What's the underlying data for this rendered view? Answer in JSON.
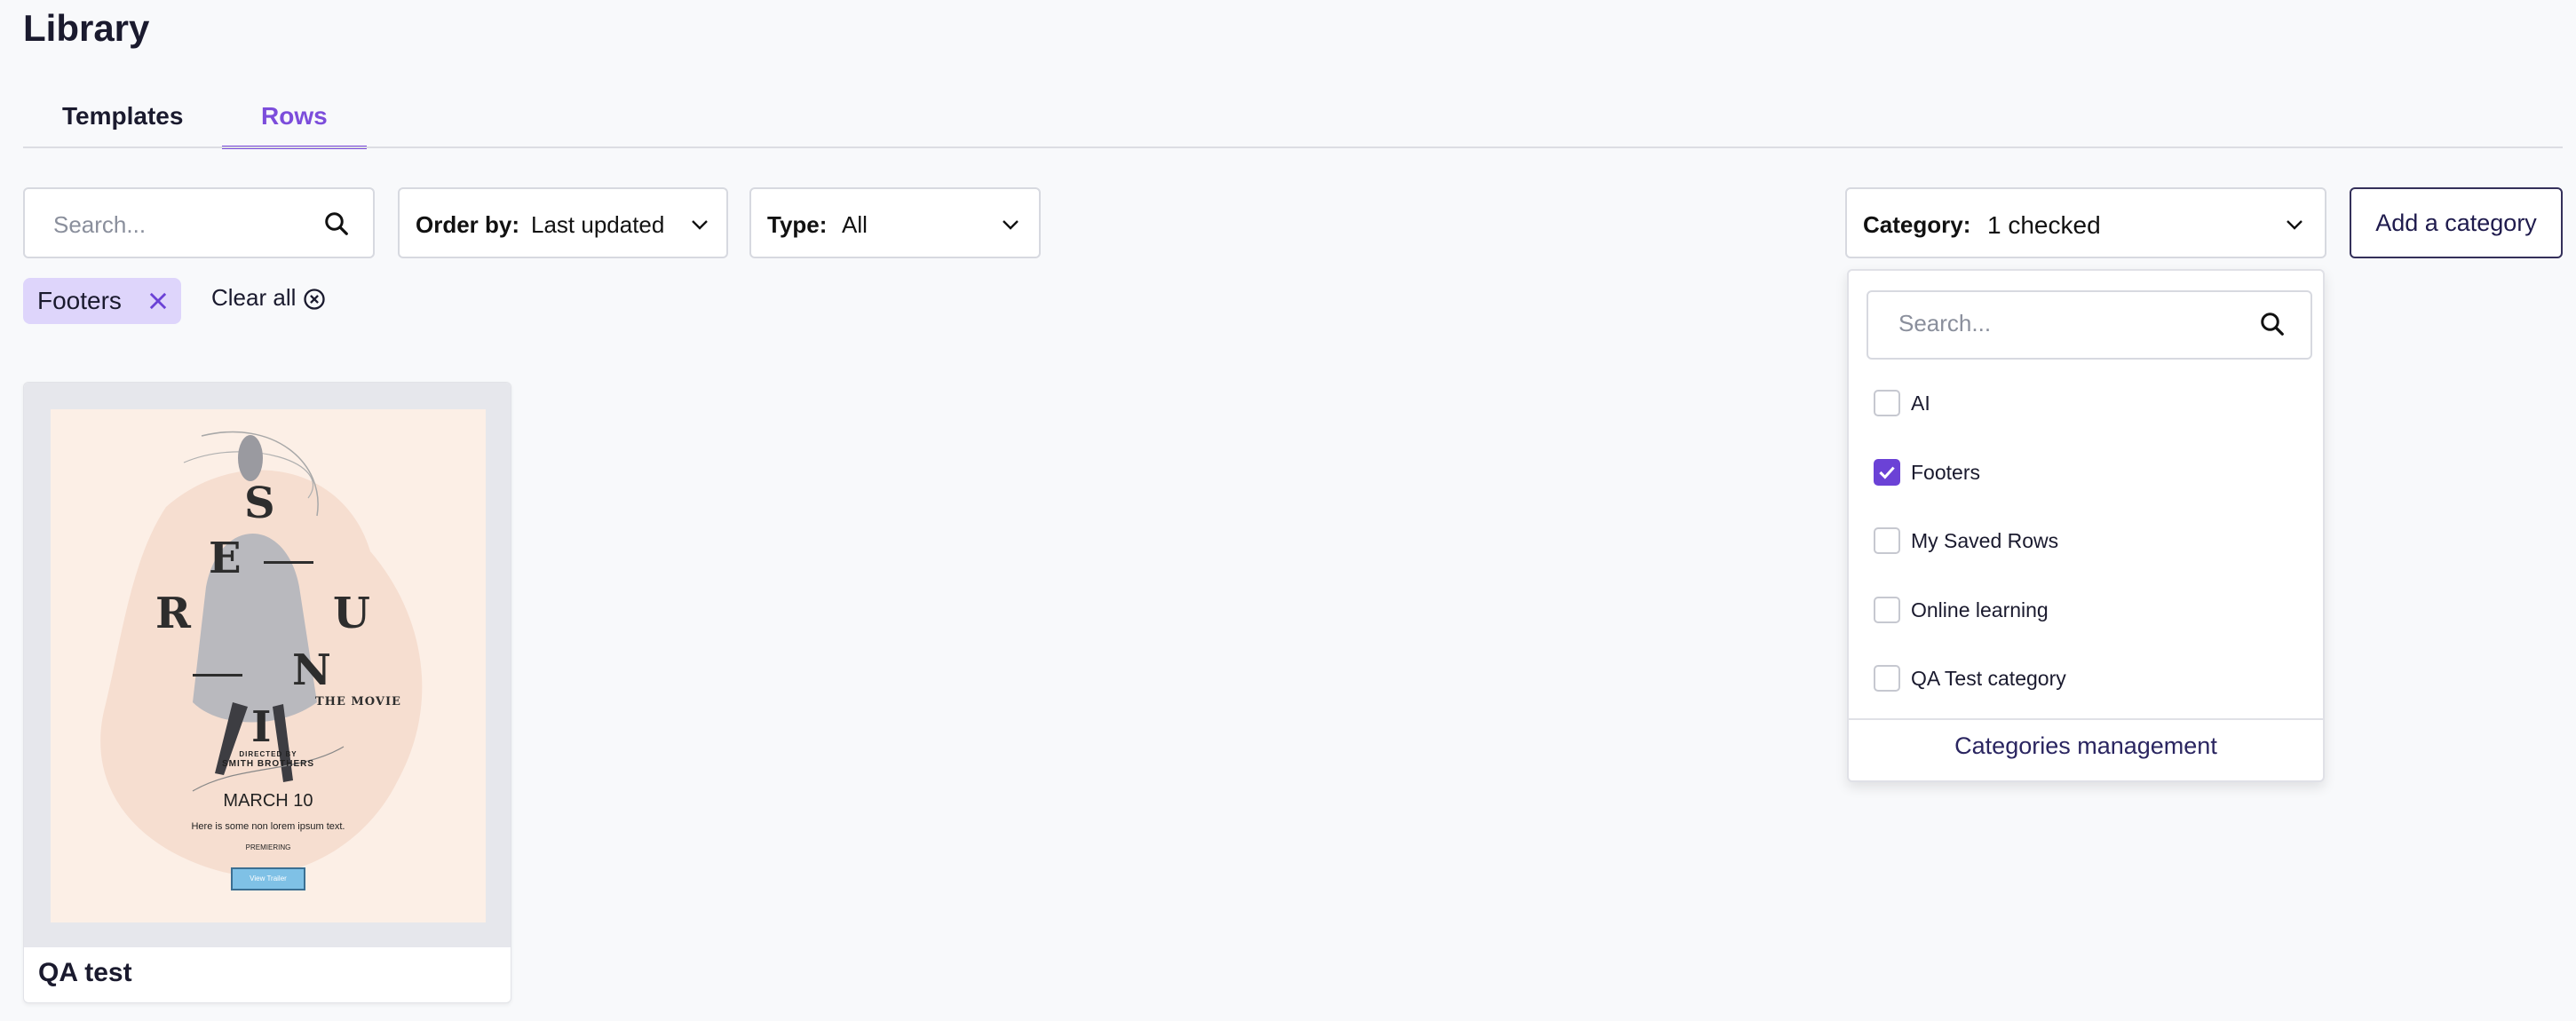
{
  "page": {
    "title": "Library"
  },
  "tabs": [
    {
      "label": "Templates",
      "active": false
    },
    {
      "label": "Rows",
      "active": true
    }
  ],
  "filters": {
    "search": {
      "placeholder": "Search...",
      "icon": "search-icon"
    },
    "order": {
      "label": "Order by:",
      "value": "Last updated"
    },
    "type": {
      "label": "Type:",
      "value": "All"
    },
    "category": {
      "label": "Category:",
      "value": "1 checked"
    },
    "add_category_label": "Add a category"
  },
  "active_filters": {
    "chips": [
      {
        "label": "Footers"
      }
    ],
    "clear_all_label": "Clear all"
  },
  "category_dropdown": {
    "search_placeholder": "Search...",
    "options": [
      {
        "label": "AI",
        "checked": false
      },
      {
        "label": "Footers",
        "checked": true
      },
      {
        "label": "My Saved Rows",
        "checked": false
      },
      {
        "label": "Online learning",
        "checked": false
      },
      {
        "label": "QA Test category",
        "checked": false
      }
    ],
    "footer_label": "Categories management"
  },
  "cards": [
    {
      "title": "QA test",
      "poster": {
        "letters": [
          "S",
          "E",
          "R",
          "U",
          "N",
          "I"
        ],
        "subtitle": "THE MOVIE",
        "directed_by": "DIRECTED BY",
        "director": "SMITH BROTHERS",
        "date": "MARCH 10",
        "body": "Here is some non lorem ipsum text.",
        "premiering": "PREMIERING",
        "button": "View Trailer"
      }
    }
  ],
  "colors": {
    "accent": "#7c4ddb",
    "checkbox_checked": "#6b42d6",
    "chip_bg": "#ded5fb",
    "poster_bg": "#fcefe6",
    "dark_text": "#1a1a2e"
  }
}
